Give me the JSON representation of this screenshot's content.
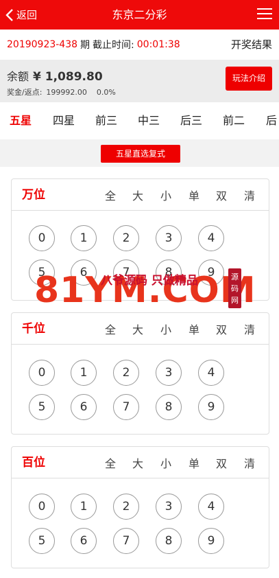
{
  "topbar": {
    "back_label": "返回",
    "title": "东京二分彩"
  },
  "issue": {
    "number": "20190923-438",
    "period_label": "期",
    "deadline_label": "截止时间:",
    "countdown": "00:01:38",
    "results_label": "开奖结果"
  },
  "account": {
    "balance_label": "余额",
    "balance_value": "¥ 1,089.80",
    "bonus_label": "奖金/返点:",
    "bonus_value": "199992.00",
    "rebate_value": "0.0%",
    "intro_button": "玩法介绍"
  },
  "tabs": [
    {
      "label": "五星",
      "active": true
    },
    {
      "label": "四星",
      "active": false
    },
    {
      "label": "前三",
      "active": false
    },
    {
      "label": "中三",
      "active": false
    },
    {
      "label": "后三",
      "active": false
    },
    {
      "label": "前二",
      "active": false
    },
    {
      "label": "后二",
      "active": false
    }
  ],
  "subtype": "五星直选复式",
  "quick_labels": [
    "全",
    "大",
    "小",
    "单",
    "双",
    "清"
  ],
  "panels": [
    {
      "position": "万位",
      "balls": [
        "0",
        "1",
        "2",
        "3",
        "4",
        "5",
        "6",
        "7",
        "8",
        "9"
      ]
    },
    {
      "position": "千位",
      "balls": [
        "0",
        "1",
        "2",
        "3",
        "4",
        "5",
        "6",
        "7",
        "8",
        "9"
      ]
    },
    {
      "position": "百位",
      "balls": [
        "0",
        "1",
        "2",
        "3",
        "4",
        "5",
        "6",
        "7",
        "8",
        "9"
      ]
    }
  ],
  "watermark": {
    "main": "81YM.COM",
    "slogan": "八爷源码 只做精品",
    "seal": "源码网"
  },
  "colors": {
    "brand_red": "#ee0a0a",
    "watermark_orange": "#e8341c"
  }
}
